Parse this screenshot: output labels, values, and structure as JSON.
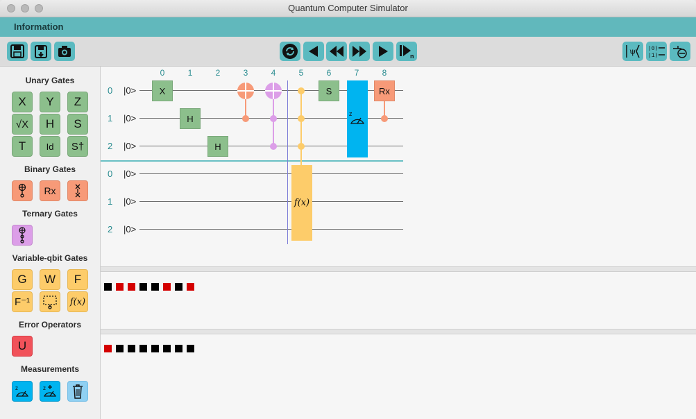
{
  "window": {
    "title": "Quantum Computer Simulator"
  },
  "menu": {
    "information": "Information"
  },
  "toolbar": {
    "left": [
      "save-icon",
      "save-as-icon",
      "camera-icon"
    ],
    "center": [
      "refresh-icon",
      "step-back-icon",
      "rewind-icon",
      "fast-forward-icon",
      "play-icon",
      "step-n-icon"
    ],
    "right": [
      "state-vector-icon",
      "ket-registers-icon",
      "measure-reset-icon"
    ]
  },
  "sidebar": {
    "unary_title": "Unary Gates",
    "unary": [
      "X",
      "Y",
      "Z",
      "√X",
      "H",
      "S",
      "T",
      "Id",
      "S†"
    ],
    "binary_title": "Binary Gates",
    "binary_rx": "Rx",
    "ternary_title": "Ternary Gates",
    "variable_title": "Variable-qbit Gates",
    "variable": [
      "G",
      "W",
      "F",
      "F⁻¹"
    ],
    "fx": "f(x)",
    "error_title": "Error Operators",
    "error_u": "U",
    "measure_title": "Measurements"
  },
  "circuit": {
    "columns": [
      "0",
      "1",
      "2",
      "3",
      "4",
      "5",
      "6",
      "7",
      "8"
    ],
    "rows_top": [
      "0",
      "1",
      "2"
    ],
    "rows_bottom": [
      "0",
      "1",
      "2"
    ],
    "ket": "|0>",
    "gates": {
      "x0": "X",
      "h1": "H",
      "h2": "H",
      "s6": "S",
      "rx8": "Rx",
      "fx5": "f(x)"
    }
  },
  "registers": {
    "first": [
      "black",
      "red",
      "red",
      "black",
      "black",
      "red",
      "black",
      "red"
    ],
    "second": [
      "red",
      "black",
      "black",
      "black",
      "black",
      "black",
      "black",
      "black"
    ]
  },
  "colors": {
    "teal": "#61b8bc",
    "green": "#8cbf8c",
    "orange": "#f79a78",
    "pink": "#dc9ee8",
    "yellow": "#fdcc6a",
    "blue": "#00b4f0",
    "red": "#d40000"
  }
}
